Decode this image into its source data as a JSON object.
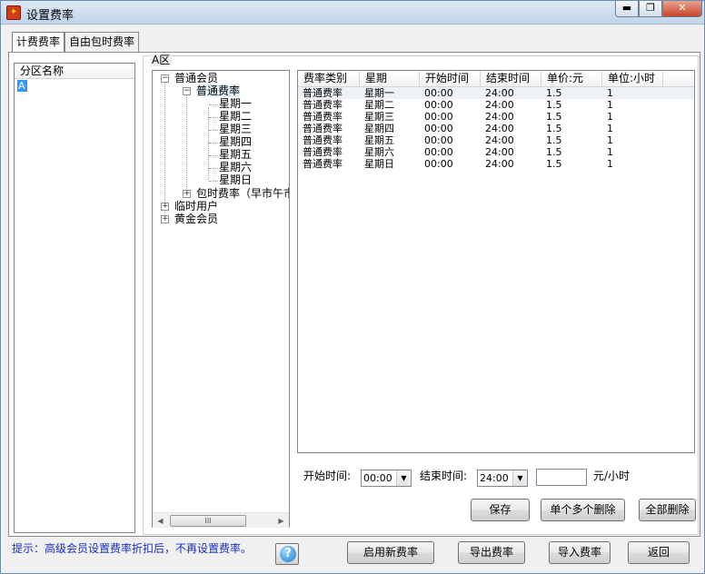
{
  "window": {
    "title": "设置费率",
    "icon": "app-icon",
    "minimize": "▬",
    "maximize": "❐",
    "close": "✕"
  },
  "tabs": [
    {
      "label": "计费费率"
    },
    {
      "label": "自由包时费率"
    }
  ],
  "zone_list": {
    "header": "分区名称",
    "items": [
      "A"
    ]
  },
  "zone_group": {
    "label": "A区"
  },
  "tree": {
    "nodes": [
      "普通会员",
      "普通费率",
      "星期一",
      "星期二",
      "星期三",
      "星期四",
      "星期五",
      "星期六",
      "星期日",
      "包时费率（早市午市",
      "临时用户",
      "黄金会员"
    ],
    "expand_open": "−",
    "expand_closed": "+"
  },
  "hscroll": {
    "left": "◀",
    "right": "▶",
    "thumb": "III"
  },
  "rate_table": {
    "columns": [
      "费率类别",
      "星期",
      "开始时间",
      "结束时间",
      "单价:元",
      "单位:小时"
    ],
    "rows": [
      [
        "普通费率",
        "星期一",
        "00:00",
        "24:00",
        "1.5",
        "1"
      ],
      [
        "普通费率",
        "星期二",
        "00:00",
        "24:00",
        "1.5",
        "1"
      ],
      [
        "普通费率",
        "星期三",
        "00:00",
        "24:00",
        "1.5",
        "1"
      ],
      [
        "普通费率",
        "星期四",
        "00:00",
        "24:00",
        "1.5",
        "1"
      ],
      [
        "普通费率",
        "星期五",
        "00:00",
        "24:00",
        "1.5",
        "1"
      ],
      [
        "普通费率",
        "星期六",
        "00:00",
        "24:00",
        "1.5",
        "1"
      ],
      [
        "普通费率",
        "星期日",
        "00:00",
        "24:00",
        "1.5",
        "1"
      ]
    ]
  },
  "editor": {
    "start_label": "开始时间:",
    "start_value": "00:00",
    "end_label": "结束时间:",
    "end_value": "24:00",
    "dropdown_arrow": "▼",
    "price_value": "",
    "price_unit": "元/小时"
  },
  "buttons": {
    "save": "保存",
    "delete_selected": "单个多个删除",
    "delete_all": "全部删除",
    "enable_new": "启用新费率",
    "export": "导出费率",
    "import": "导入费率",
    "back": "返回"
  },
  "hint": "提示：高级会员设置费率折扣后，不再设置费率。",
  "help": {
    "glyph": "?"
  }
}
